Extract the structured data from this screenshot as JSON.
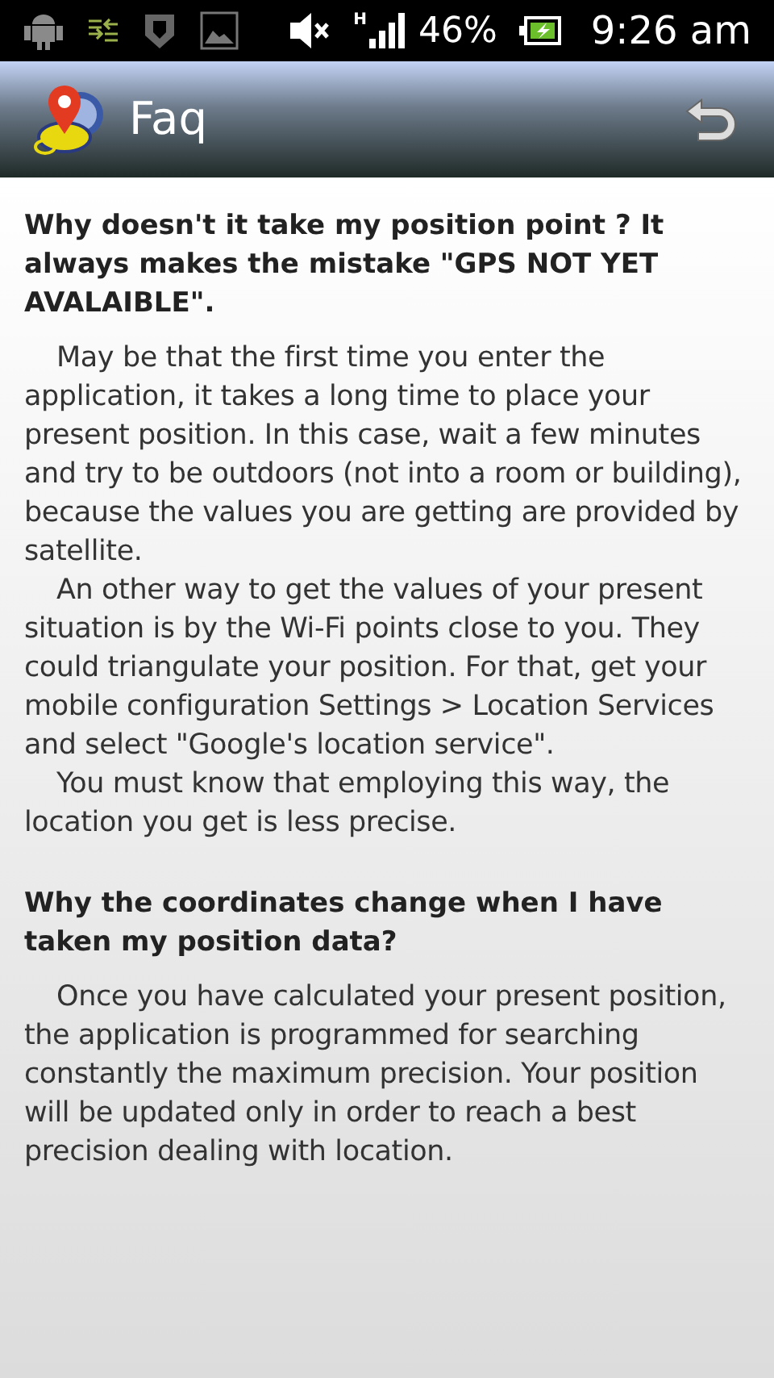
{
  "status_bar": {
    "network_type": "H",
    "battery": "46%",
    "time": "9:26 am"
  },
  "action_bar": {
    "title": "Faq"
  },
  "faq": [
    {
      "question": "Why doesn't it take my position point ? It always makes the mistake \"GPS NOT YET AVALAIBLE\".",
      "paragraphs": [
        "May be that the first time you enter the application, it takes a long time to place your present position. In this case, wait a few minutes and try to be outdoors (not into a room or building), because the values you are getting are provided by satellite.",
        "An other way to get the values of your present situation is by the Wi-Fi points close to you. They could triangulate your position. For that, get your mobile configuration Settings > Location Services and select \"Google's location service\".",
        "You must know that employing this way, the location you get is less precise."
      ]
    },
    {
      "question": "Why the coordinates change when I have taken my position data?",
      "paragraphs": [
        "Once you have calculated your present position, the application is programmed for searching constantly the maximum precision. Your position will be updated only in order to reach a best precision dealing with location."
      ]
    }
  ]
}
